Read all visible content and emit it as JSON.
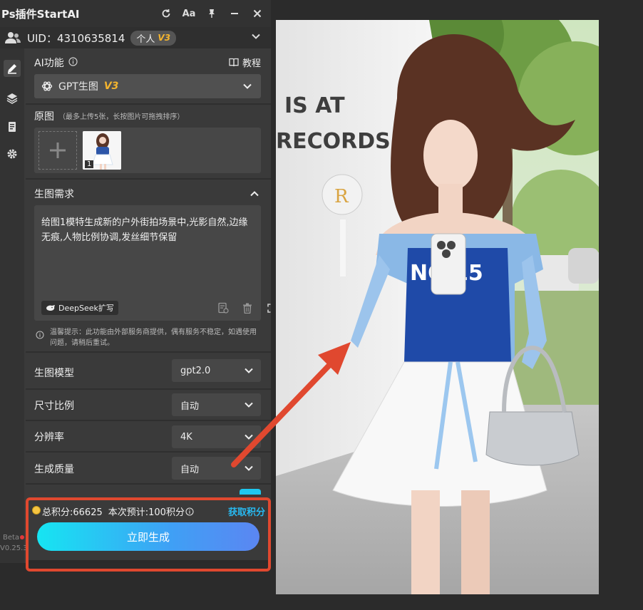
{
  "titlebar": {
    "title": "Ps插件StartAI",
    "font_label": "Aa"
  },
  "user": {
    "uid": "UID：4310635814",
    "plan": "个人",
    "plan_version": "V3"
  },
  "sidebar": {
    "beta": "Beta",
    "version": "V0.25.3"
  },
  "ai_function": {
    "label": "AI功能",
    "tutorial": "教程",
    "selected_model": "GPT生图",
    "selected_version": "V3"
  },
  "original_image": {
    "title": "原图",
    "hint": "（最多上传5张，长按图片可拖拽排序）",
    "thumb_index": "1"
  },
  "generation": {
    "title": "生图需求",
    "prompt": "给图1模特生成新的户外街拍场景中,光影自然,边缘无痕,人物比例协调,发丝细节保留",
    "deepseek_label": "DeepSeek扩写",
    "tip": "温馨提示：此功能由外部服务商提供，偶有服务不稳定，如遇使用问题，请稍后重试。"
  },
  "settings": [
    {
      "label": "生图模型",
      "value": "gpt2.0"
    },
    {
      "label": "尺寸比例",
      "value": "自动"
    },
    {
      "label": "分辨率",
      "value": "4K"
    },
    {
      "label": "生成质量",
      "value": "自动"
    }
  ],
  "footer": {
    "total_points": "总积分:66625",
    "estimate": "本次预计:100积分",
    "get_points": "获取积分",
    "generate": "立即生成"
  },
  "photo": {
    "wall_text": [
      "IS AT",
      "RECORDS"
    ],
    "shirt_text": "NO 15"
  },
  "colors": {
    "accent_red": "#e0482f",
    "link_blue": "#28b9f0",
    "plan_gold": "#f5b52e",
    "button_gradient_start": "#16e5f2",
    "button_gradient_end": "#5b86f2"
  }
}
